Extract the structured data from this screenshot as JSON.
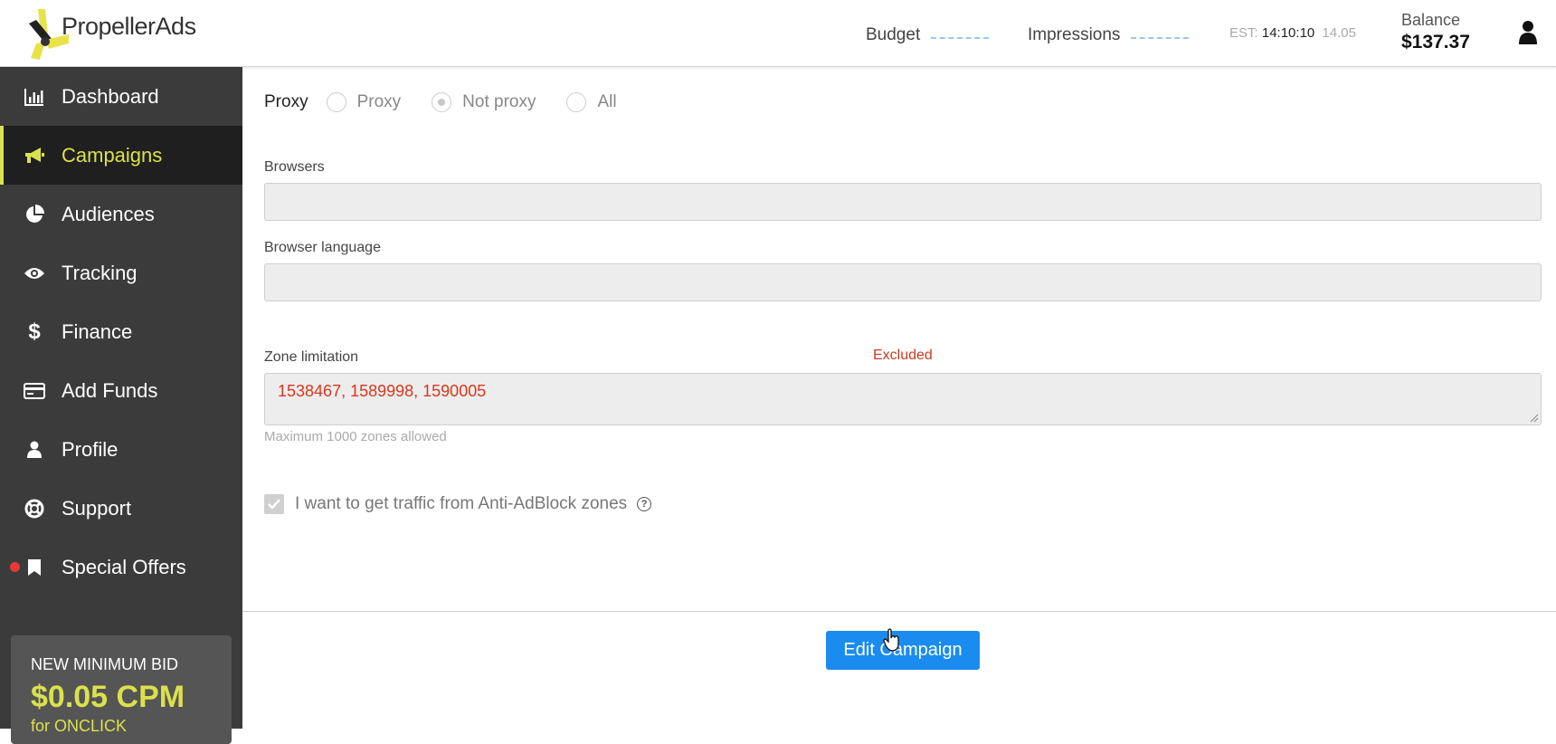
{
  "brand": {
    "name": "PropellerAds",
    "accent": "#dbe14c"
  },
  "header": {
    "budget_label": "Budget",
    "impressions_label": "Impressions",
    "est_label": "EST:",
    "est_time": "14:10:10",
    "est_rate": "14.05",
    "balance_label": "Balance",
    "balance_value": "$137.37"
  },
  "sidebar": {
    "items": [
      {
        "label": "Dashboard",
        "icon": "bar-chart-icon"
      },
      {
        "label": "Campaigns",
        "icon": "megaphone-icon",
        "active": true
      },
      {
        "label": "Audiences",
        "icon": "pie-chart-icon"
      },
      {
        "label": "Tracking",
        "icon": "eye-icon"
      },
      {
        "label": "Finance",
        "icon": "dollar-icon"
      },
      {
        "label": "Add Funds",
        "icon": "credit-card-icon"
      },
      {
        "label": "Profile",
        "icon": "user-icon"
      },
      {
        "label": "Support",
        "icon": "lifebuoy-icon"
      },
      {
        "label": "Special Offers",
        "icon": "bookmark-icon",
        "notification": true
      }
    ],
    "promo": {
      "line1": "NEW MINIMUM BID",
      "line2": "$0.05 CPM",
      "line3": "for ONCLICK"
    }
  },
  "form": {
    "proxy": {
      "label": "Proxy",
      "options": [
        "Proxy",
        "Not proxy",
        "All"
      ],
      "selected": "Not proxy"
    },
    "browsers_label": "Browsers",
    "browser_language_label": "Browser language",
    "zone_limitation_label": "Zone limitation",
    "zone_mode": "Excluded",
    "zone_value": "1538467, 1589998, 1590005",
    "zone_hint": "Maximum 1000 zones allowed",
    "antiadblock_label": "I want to get traffic from Anti-AdBlock zones",
    "antiadblock_checked": true,
    "submit_label": "Edit Campaign"
  }
}
